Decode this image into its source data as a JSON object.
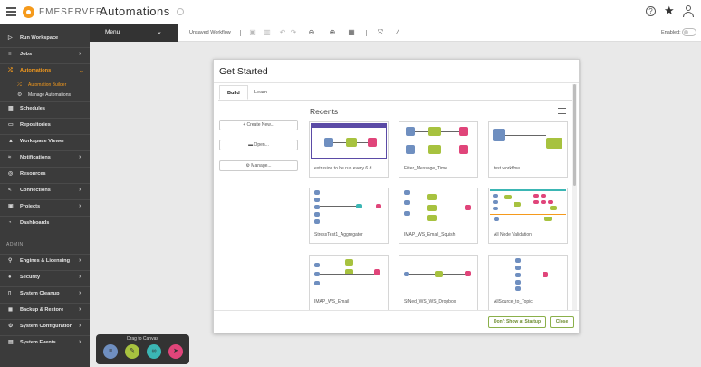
{
  "topbar": {
    "brand": "FMESERVER",
    "title": "Automations",
    "help_glyph": "?"
  },
  "sidebar": {
    "items": [
      {
        "label": "Run Workspace",
        "icon": "play-icon"
      },
      {
        "label": "Jobs",
        "icon": "jobs-icon"
      },
      {
        "label": "Automations",
        "icon": "automations-icon"
      },
      {
        "label": "Automation Builder",
        "icon": "builder-icon"
      },
      {
        "label": "Manage Automations",
        "icon": "manage-icon"
      },
      {
        "label": "Schedules",
        "icon": "calendar-icon"
      },
      {
        "label": "Repositories",
        "icon": "folder-icon"
      },
      {
        "label": "Workspace Viewer",
        "icon": "viewer-icon"
      },
      {
        "label": "Notifications",
        "icon": "notifications-icon"
      },
      {
        "label": "Resources",
        "icon": "resources-icon"
      },
      {
        "label": "Connections",
        "icon": "connections-icon"
      },
      {
        "label": "Projects",
        "icon": "projects-icon"
      },
      {
        "label": "Dashboards",
        "icon": "dashboards-icon"
      }
    ],
    "admin_label": "ADMIN",
    "admin_items": [
      {
        "label": "Engines & Licensing",
        "icon": "engine-icon"
      },
      {
        "label": "Security",
        "icon": "security-icon"
      },
      {
        "label": "System Cleanup",
        "icon": "cleanup-icon"
      },
      {
        "label": "Backup & Restore",
        "icon": "backup-icon"
      },
      {
        "label": "System Configuration",
        "icon": "config-icon"
      },
      {
        "label": "System Events",
        "icon": "events-icon"
      }
    ]
  },
  "toolbar": {
    "menu_label": "Menu",
    "workflow_name": "Unsaved Workflow",
    "enabled_label": "Enabled:"
  },
  "dialog": {
    "title": "Get Started",
    "tabs": [
      "Build",
      "Learn"
    ],
    "buttons": {
      "create_new": "+ Create New...",
      "open": "▬ Open...",
      "manage": "⚙ Manage..."
    },
    "recents_title": "Recents",
    "recents": [
      "extrusion to be run every 6 d...",
      "Filter_Message_Time",
      "test workflow",
      "StressTest1_Aggregator",
      "IMAP_WS_Email_Squish",
      "All Node Validation",
      "IMAP_WS_Email",
      "SfNed_WS_WS_Dropbox",
      "AllSource_to_Topic"
    ],
    "footer": {
      "dont_show": "Don't Show at Startup",
      "close": "Close"
    }
  },
  "drag_panel": {
    "label": "Drag to Canvas"
  },
  "colors": {
    "accent": "#f59a1c",
    "sidebar_bg": "#3b3b3b",
    "node_blue": "#6f8fc0",
    "node_green": "#a7c23f",
    "node_pink": "#e0457a",
    "node_teal": "#3bb6b4",
    "button_green": "#8bb04a"
  }
}
